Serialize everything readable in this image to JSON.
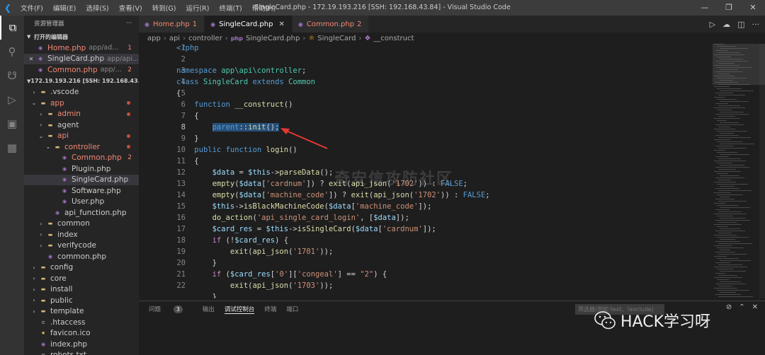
{
  "titlebar": {
    "menu": [
      "文件(F)",
      "编辑(E)",
      "选择(S)",
      "查看(V)",
      "转到(G)",
      "运行(R)",
      "终端(T)",
      "帮助(H)"
    ],
    "title": "SingleCard.php - 172.19.193.216 [SSH: 192.168.43.84] - Visual Studio Code"
  },
  "sidebar": {
    "header": "资源管理器",
    "open_editors_title": "打开的编辑器",
    "open_editors": [
      {
        "name": "Home.php",
        "desc": "app/ad...",
        "badge": "1",
        "error": true
      },
      {
        "name": "SingleCard.php",
        "desc": "app/api...",
        "badge": "",
        "error": false
      },
      {
        "name": "Common.php",
        "desc": "app/...",
        "badge": "2",
        "error": true
      }
    ],
    "remote_title": "172.19.193.216 [SSH: 192.168.43.84]",
    "tree": [
      {
        "name": ".vscode",
        "type": "folder",
        "depth": 0,
        "open": false,
        "error": false
      },
      {
        "name": "app",
        "type": "folder",
        "depth": 0,
        "open": true,
        "error": true
      },
      {
        "name": "admin",
        "type": "folder",
        "depth": 1,
        "open": false,
        "error": true
      },
      {
        "name": "agent",
        "type": "folder",
        "depth": 1,
        "open": false,
        "error": false
      },
      {
        "name": "api",
        "type": "folder",
        "depth": 1,
        "open": true,
        "error": true
      },
      {
        "name": "controller",
        "type": "folder",
        "depth": 2,
        "open": true,
        "error": true
      },
      {
        "name": "Common.php",
        "type": "php",
        "depth": 3,
        "error": true,
        "badge": "2"
      },
      {
        "name": "Plugin.php",
        "type": "php",
        "depth": 3,
        "error": false
      },
      {
        "name": "SingleCard.php",
        "type": "php",
        "depth": 3,
        "error": false,
        "selected": true
      },
      {
        "name": "Software.php",
        "type": "php",
        "depth": 3,
        "error": false
      },
      {
        "name": "User.php",
        "type": "php",
        "depth": 3,
        "error": false
      },
      {
        "name": "api_function.php",
        "type": "php",
        "depth": 2,
        "error": false
      },
      {
        "name": "common",
        "type": "folder",
        "depth": 1,
        "open": false,
        "error": false
      },
      {
        "name": "index",
        "type": "folder",
        "depth": 1,
        "open": false,
        "error": false
      },
      {
        "name": "verifycode",
        "type": "folder",
        "depth": 1,
        "open": false,
        "error": false
      },
      {
        "name": "common.php",
        "type": "php",
        "depth": 1,
        "error": false
      },
      {
        "name": "config",
        "type": "folder",
        "depth": 0,
        "open": false,
        "error": false
      },
      {
        "name": "core",
        "type": "folder",
        "depth": 0,
        "open": false,
        "error": false
      },
      {
        "name": "install",
        "type": "folder",
        "depth": 0,
        "open": false,
        "error": false
      },
      {
        "name": "public",
        "type": "folder",
        "depth": 0,
        "open": false,
        "error": false
      },
      {
        "name": "template",
        "type": "folder",
        "depth": 0,
        "open": false,
        "error": false
      },
      {
        "name": ".htaccess",
        "type": "file",
        "depth": 0,
        "error": false
      },
      {
        "name": "favicon.ico",
        "type": "star",
        "depth": 0,
        "error": false
      },
      {
        "name": "index.php",
        "type": "php",
        "depth": 0,
        "error": false
      },
      {
        "name": "robots.txt",
        "type": "file",
        "depth": 0,
        "error": false
      }
    ]
  },
  "tabs": [
    {
      "name": "Home.php",
      "badge": "1",
      "error": true,
      "active": false
    },
    {
      "name": "SingleCard.php",
      "badge": "",
      "error": false,
      "active": true
    },
    {
      "name": "Common.php",
      "badge": "2",
      "error": true,
      "active": false
    }
  ],
  "breadcrumb": [
    "app",
    "api",
    "controller",
    "SingleCard.php",
    "SingleCard",
    "__construct"
  ],
  "code": {
    "lines": [
      "1",
      "2",
      "3",
      "4",
      "5",
      "6",
      "7",
      "8",
      "9",
      "10",
      "11",
      "12",
      "13",
      "14",
      "15",
      "16",
      "17",
      "18",
      "19",
      "20",
      "21",
      "22"
    ],
    "current_line": "8"
  },
  "watermark": "奇安信攻防社区",
  "panel": {
    "tabs": [
      "问题",
      "输出",
      "调试控制台",
      "终端",
      "端口"
    ],
    "problems_count": "3",
    "active_tab": "调试控制台",
    "filter_placeholder": "筛选器(例如 text、!exclude)"
  },
  "brand": {
    "text": "HACK学习呀"
  }
}
